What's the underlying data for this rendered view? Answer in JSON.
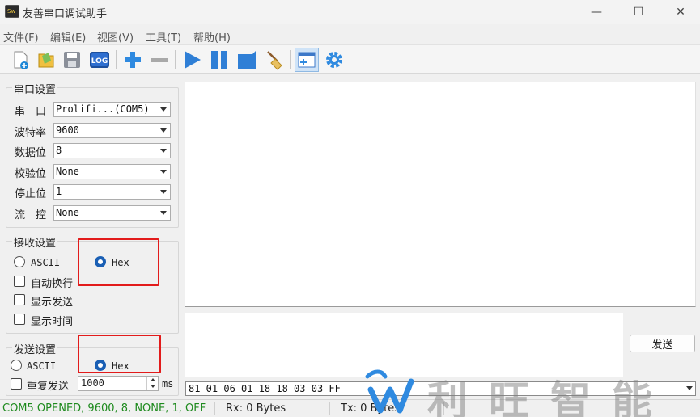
{
  "window": {
    "title": "友善串口调试助手",
    "icon_text": "Sw",
    "minimize": "—",
    "maximize": "☐",
    "close": "✕"
  },
  "menu": [
    "文件(F)",
    "编辑(E)",
    "视图(V)",
    "工具(T)",
    "帮助(H)"
  ],
  "toolbar": {
    "icons": [
      "new-file-icon",
      "open-file-icon",
      "save-icon",
      "log-icon",
      "add-icon",
      "remove-icon",
      "play-icon",
      "pause-icon",
      "stop-icon",
      "clear-broom-icon",
      "new-window-icon",
      "settings-gear-icon"
    ],
    "log_label": "LOG"
  },
  "serial": {
    "title": "串口设置",
    "rows": [
      {
        "label": "串　口",
        "value": "Prolifi...(COM5)"
      },
      {
        "label": "波特率",
        "value": "9600"
      },
      {
        "label": "数据位",
        "value": "8"
      },
      {
        "label": "校验位",
        "value": "None"
      },
      {
        "label": "停止位",
        "value": "1"
      },
      {
        "label": "流　控",
        "value": "None"
      }
    ]
  },
  "receive": {
    "title": "接收设置",
    "ascii": "ASCII",
    "hex": "Hex",
    "selected": "Hex",
    "auto_newline": "自动换行",
    "show_send": "显示发送",
    "show_time": "显示时间"
  },
  "send": {
    "title": "发送设置",
    "ascii": "ASCII",
    "hex": "Hex",
    "selected": "Hex",
    "repeat": "重复发送",
    "interval": "1000",
    "unit": "ms",
    "button": "发送"
  },
  "history": {
    "value": "81 01 06 01 18 18 03 03 FF"
  },
  "status": {
    "port": "COM5 OPENED, 9600, 8, NONE, 1, OFF",
    "rx": "Rx: 0 Bytes",
    "tx": "Tx: 0 Bytes"
  },
  "colors": {
    "status_port": "#1e8a1e",
    "highlight_box": "#e21b1b",
    "accent": "#1a5fb4"
  },
  "watermark": {
    "text": "利旺智能"
  }
}
